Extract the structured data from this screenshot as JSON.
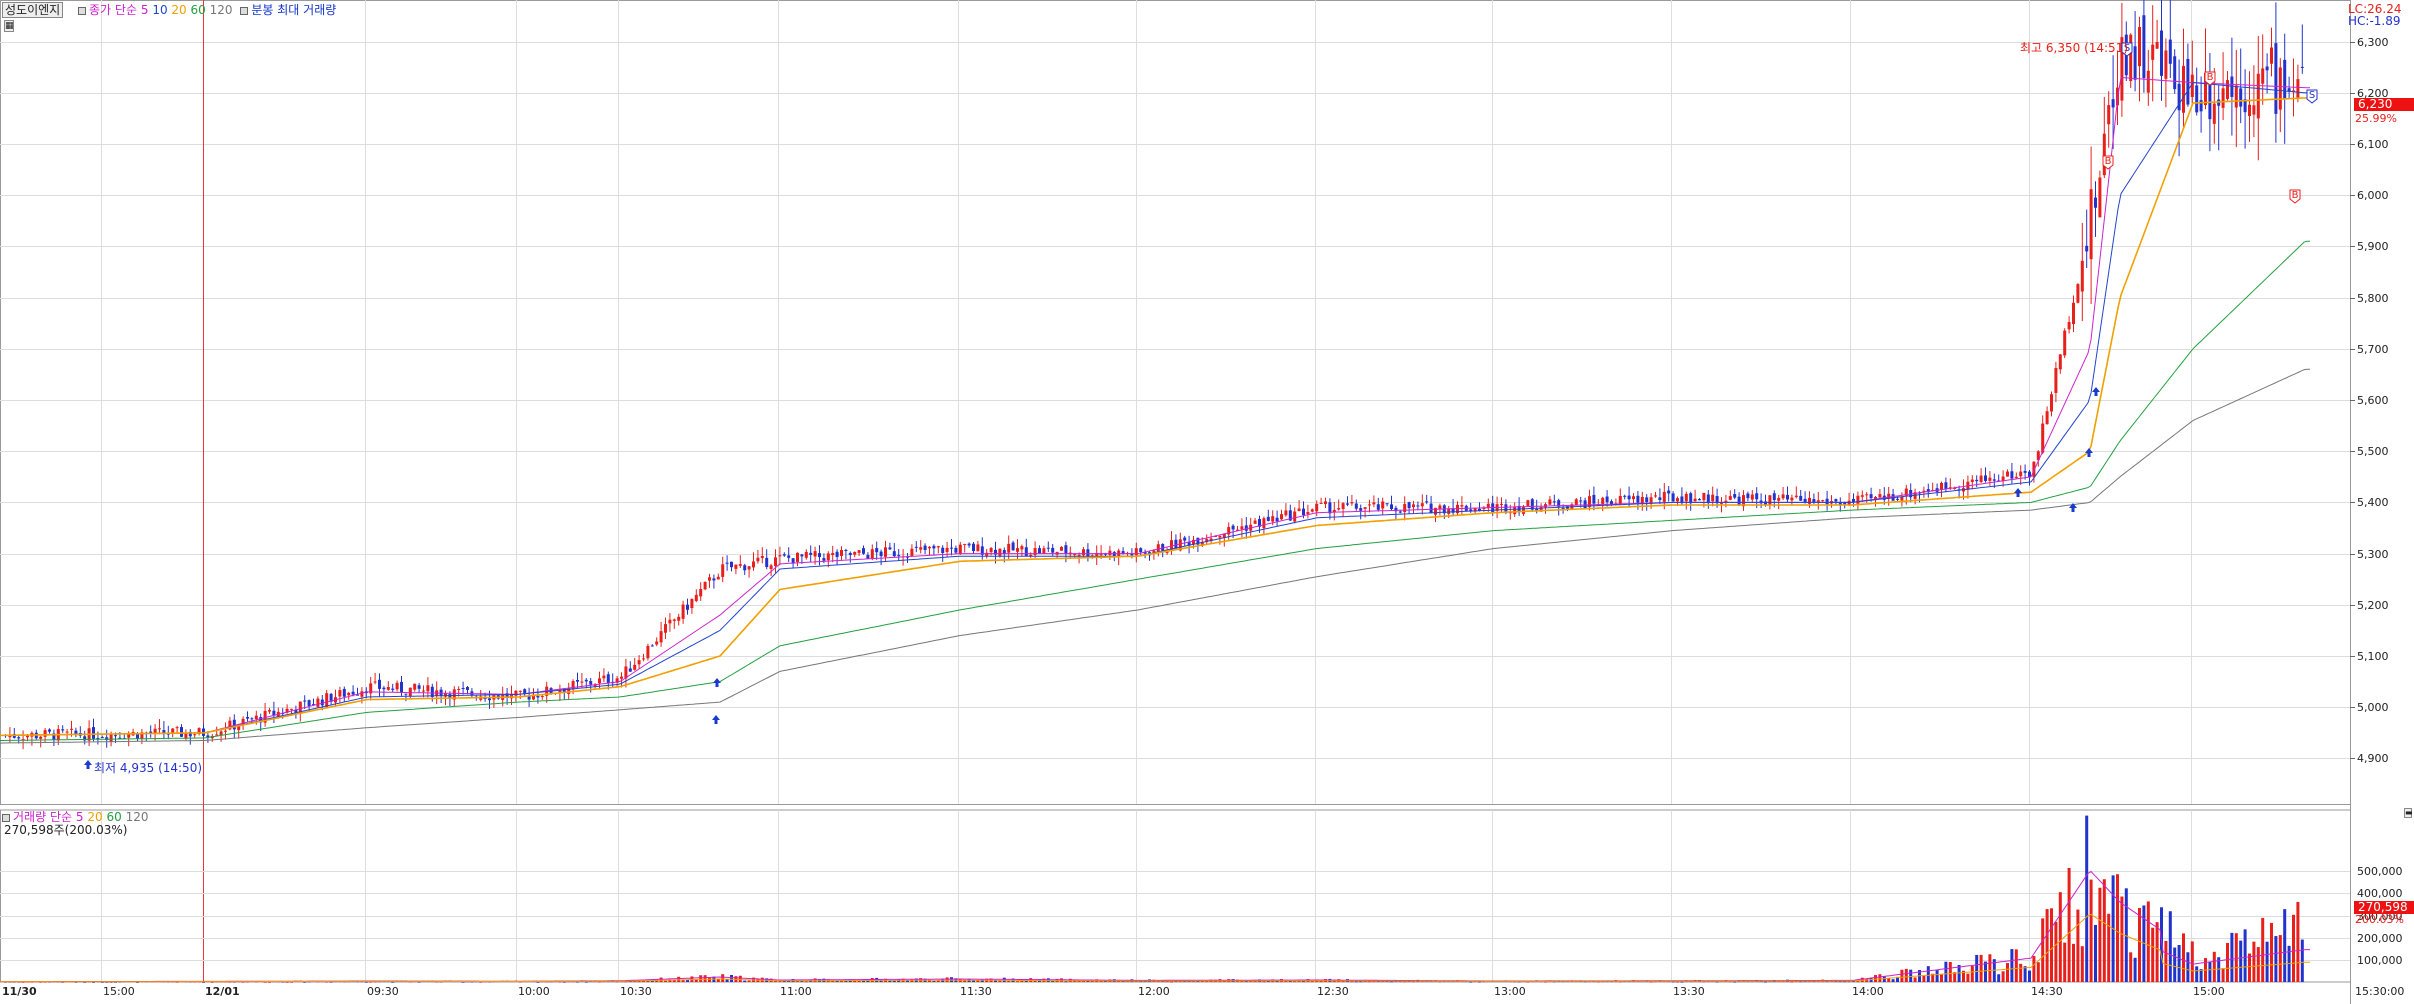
{
  "toolbar": {
    "stock_name": "성도이엔지",
    "price_label": "종가",
    "ma_label": "단순",
    "ma_periods": [
      "5",
      "10",
      "20",
      "60",
      "120"
    ],
    "extra_label": "분봉 최대 거래량"
  },
  "indicators": {
    "lc": "LC:26.24",
    "hc": "HC:-1.89"
  },
  "annotations": {
    "high": "최고 6,350 (14:51)",
    "low": "최저 4,935 (14:50)",
    "sell_mark": "S",
    "buy_mark": "B"
  },
  "price_axis": {
    "ticks": [
      "6,300",
      "6,200",
      "6,100",
      "6,000",
      "5,900",
      "5,800",
      "5,700",
      "5,600",
      "5,500",
      "5,400",
      "5,300",
      "5,200",
      "5,100",
      "5,000",
      "4,900"
    ],
    "current_price": "6,230",
    "current_change": "25.99%"
  },
  "volume_panel": {
    "label": "거래량",
    "ma_label": "단순",
    "ma_periods": [
      "5",
      "20",
      "60",
      "120"
    ],
    "summary": "270,598주(200.03%)",
    "ticks": [
      "500,000",
      "400,000",
      "300,000",
      "200,000",
      "100,000"
    ],
    "current_volume": "270,598",
    "current_pct": "200.03%"
  },
  "time_axis": {
    "labels": [
      "11/30",
      "15:00",
      "12/01",
      "09:30",
      "10:00",
      "10:30",
      "11:00",
      "11:30",
      "12:00",
      "12:30",
      "13:00",
      "13:30",
      "14:00",
      "14:30",
      "15:00",
      "15:30:00"
    ]
  },
  "colors": {
    "up": "#e8201c",
    "down": "#2233cc",
    "ma5": "#cc22cc",
    "ma10": "#2244cc",
    "ma20": "#f0a000",
    "ma60": "#22a040",
    "ma120": "#777777",
    "grid": "#dddddd",
    "price_tag": "#ee1111"
  },
  "chart_data": {
    "type": "candlestick",
    "title": "",
    "x": [
      "11/30 15:00",
      "09:00",
      "09:30",
      "10:00",
      "10:30",
      "10:45",
      "11:00",
      "11:30",
      "12:00",
      "12:30",
      "13:00",
      "13:30",
      "14:00",
      "14:30",
      "14:45",
      "14:51",
      "15:00",
      "15:20"
    ],
    "close": [
      4945,
      4950,
      5040,
      5020,
      5060,
      5270,
      5290,
      5310,
      5300,
      5390,
      5390,
      5410,
      5400,
      5460,
      5950,
      6300,
      6210,
      6230
    ],
    "ma_series": [
      {
        "name": "5",
        "values": [
          4945,
          4950,
          5030,
          5025,
          5050,
          5180,
          5280,
          5300,
          5300,
          5380,
          5390,
          5400,
          5400,
          5450,
          5700,
          6230,
          6220,
          6210
        ]
      },
      {
        "name": "10",
        "values": [
          4945,
          4950,
          5020,
          5025,
          5045,
          5150,
          5270,
          5295,
          5295,
          5370,
          5385,
          5400,
          5400,
          5440,
          5600,
          6000,
          6220,
          6200
        ]
      },
      {
        "name": "20",
        "values": [
          4945,
          4950,
          5015,
          5020,
          5040,
          5100,
          5230,
          5285,
          5295,
          5355,
          5380,
          5395,
          5395,
          5420,
          5500,
          5800,
          6180,
          6190
        ]
      },
      {
        "name": "60",
        "values": [
          4935,
          4940,
          4990,
          5010,
          5020,
          5050,
          5120,
          5190,
          5250,
          5310,
          5345,
          5365,
          5385,
          5400,
          5430,
          5520,
          5700,
          5910
        ]
      },
      {
        "name": "120",
        "values": [
          4930,
          4935,
          4960,
          4980,
          4995,
          5010,
          5070,
          5140,
          5190,
          5255,
          5310,
          5345,
          5370,
          5385,
          5400,
          5450,
          5560,
          5660
        ]
      }
    ],
    "volume": [
      2000,
      3000,
      5000,
      4000,
      6000,
      25000,
      10000,
      15000,
      8000,
      10000,
      5000,
      6000,
      8000,
      120000,
      560000,
      400000,
      150000,
      270598
    ],
    "ylim": [
      4860,
      6420
    ],
    "volume_ylim": [
      0,
      600000
    ],
    "high": 6350,
    "low": 4935,
    "grid": true
  }
}
